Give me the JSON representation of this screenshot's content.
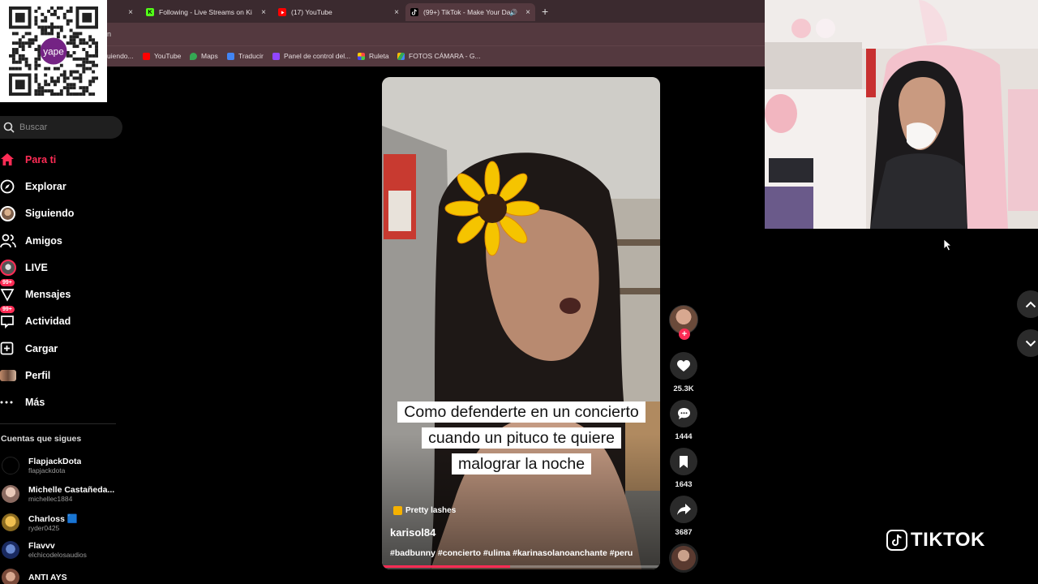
{
  "browser": {
    "tabs": [
      {
        "title": "Following - Live Streams on Ki",
        "icon": "kick-icon",
        "color": "#53fc18"
      },
      {
        "title": "(17) YouTube",
        "icon": "youtube-icon",
        "color": "#ff0000"
      },
      {
        "title": "(99+) TikTok - Make Your Da",
        "icon": "tiktok-icon",
        "color": "#ffffff"
      }
    ],
    "new_tab": "+",
    "close_glyph": "×",
    "address_partial": "n",
    "bookmarks": [
      {
        "label": "uiendo...",
        "icon": "bookmark-icon",
        "color": "#888888"
      },
      {
        "label": "YouTube",
        "icon": "youtube-icon",
        "color": "#ff0000"
      },
      {
        "label": "Maps",
        "icon": "maps-icon",
        "color": "#34a853"
      },
      {
        "label": "Traducir",
        "icon": "translate-icon",
        "color": "#4285f4"
      },
      {
        "label": "Panel de control del...",
        "icon": "twitch-icon",
        "color": "#9146ff"
      },
      {
        "label": "Ruleta",
        "icon": "wheel-icon",
        "color": "#e0a0ff"
      },
      {
        "label": "FOTOS CÁMARA - G...",
        "icon": "drive-icon",
        "color": "#fbbc04"
      }
    ]
  },
  "qr": {
    "brand": "yape",
    "accent": "#742384"
  },
  "search": {
    "placeholder": "Buscar"
  },
  "nav": [
    {
      "label": "Para ti",
      "icon": "home-icon",
      "active": true
    },
    {
      "label": "Explorar",
      "icon": "compass-icon"
    },
    {
      "label": "Siguiendo",
      "icon": "following-avatar-icon"
    },
    {
      "label": "Amigos",
      "icon": "friends-icon"
    },
    {
      "label": "LIVE",
      "icon": "live-icon"
    },
    {
      "label": "Mensajes",
      "icon": "messages-icon",
      "badge": "99+"
    },
    {
      "label": "Actividad",
      "icon": "activity-icon",
      "badge": "99+"
    },
    {
      "label": "Cargar",
      "icon": "upload-icon"
    },
    {
      "label": "Perfil",
      "icon": "profile-icon"
    },
    {
      "label": "Más",
      "icon": "more-icon"
    }
  ],
  "following": {
    "heading": "Cuentas que sigues",
    "accounts": [
      {
        "name": "FlapjackDota",
        "handle": "flapjackdota",
        "color": "#111111"
      },
      {
        "name": "Michelle Castañeda...",
        "handle": "michellec1884",
        "color": "#c9a6a0"
      },
      {
        "name": "Charloss 🟦",
        "handle": "ryder0425",
        "color": "#d9a441"
      },
      {
        "name": "Flavvv",
        "handle": "elchicodelosaudios",
        "color": "#2a4fa0"
      },
      {
        "name": "ANTI AYS",
        "handle": "",
        "color": "#b07060"
      }
    ]
  },
  "video": {
    "caption": "Como defenderte en un concierto cuando un pituco te quiere malograr la noche",
    "label": "Pretty lashes",
    "username": "karisol84",
    "hashtags": "#badbunny #concierto #ulima #karinasolanoanchante #peru",
    "progress": 0.46
  },
  "actions": {
    "likes": "25.3K",
    "comments": "1444",
    "saves": "1643",
    "shares": "3687"
  },
  "brand": {
    "logo_text": "TIKTOK",
    "accent": "#fe2c55"
  }
}
